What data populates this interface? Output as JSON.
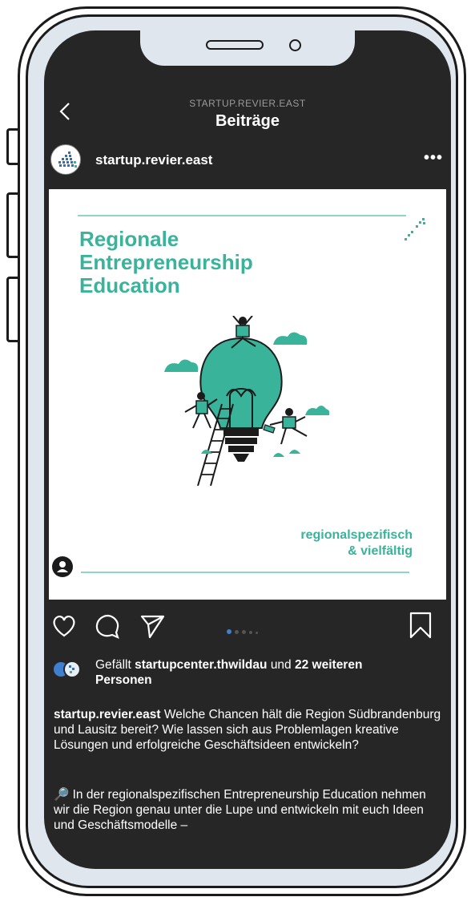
{
  "nav": {
    "account_caption": "STARTUP.REVIER.EAST",
    "title": "Beiträge"
  },
  "post": {
    "username": "startup.revier.east",
    "more_label": "•••",
    "image": {
      "headline_1": "Regionale",
      "headline_2": "Entrepreneurship",
      "headline_3": "Education",
      "tagline_1": "regionalspezifisch",
      "tagline_2": "& vielfältig"
    },
    "carousel": {
      "count": 5,
      "active": 0
    },
    "likes": {
      "prefix": "Gefällt",
      "liker": "startupcenter.thwildau",
      "middle": "und",
      "others": "22 weiteren",
      "suffix": "Personen"
    },
    "caption": {
      "author": "startup.revier.east",
      "text": "Welche Chancen hält die Region Südbrandenburg und Lausitz bereit? Wie lassen sich aus Problemlagen kreative Lösungen und erfolgreiche Geschäftsideen entwickeln?",
      "text2": "🔎 In der regionalspezifischen Entrepreneurship Education nehmen wir die Region genau unter die Lupe und entwickeln mit euch Ideen und Geschäftsmodelle –"
    }
  },
  "colors": {
    "accent_teal": "#39b39a",
    "screen_bg": "#262626",
    "dot_active": "#3f7fd0"
  },
  "icons": [
    "back-chevron-icon",
    "more-icon",
    "heart-icon",
    "comment-icon",
    "share-icon",
    "bookmark-icon",
    "user-tag-icon"
  ]
}
